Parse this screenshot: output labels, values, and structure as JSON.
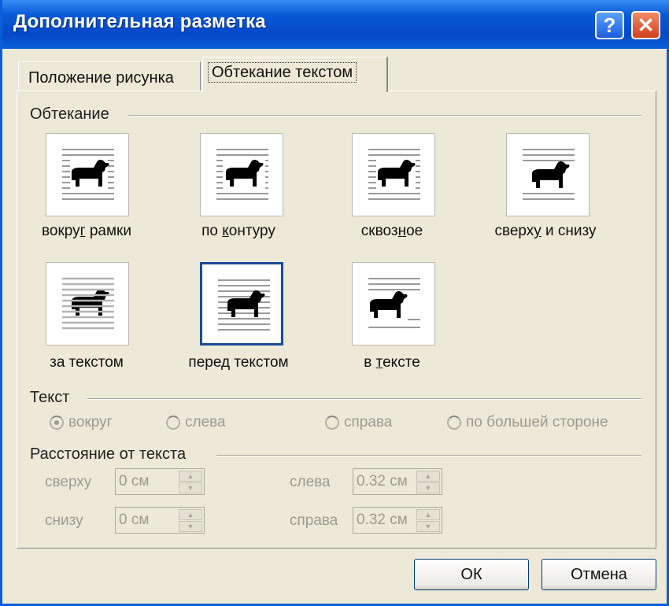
{
  "window": {
    "title": "Дополнительная разметка",
    "help_icon": "?",
    "close_icon": "✕"
  },
  "tabs": [
    {
      "label": "Положение рисунка",
      "active": false
    },
    {
      "label": "Обтекание текстом",
      "active": true
    }
  ],
  "wrapping": {
    "group_label": "Обтекание",
    "options": [
      {
        "pre": "вокру",
        "ul": "г",
        "post": " рамки",
        "icon": "square-wrap-icon",
        "selected": false
      },
      {
        "pre": "по ",
        "ul": "к",
        "post": "онтуру",
        "icon": "tight-wrap-icon",
        "selected": false
      },
      {
        "pre": "сквоз",
        "ul": "н",
        "post": "ое",
        "icon": "through-wrap-icon",
        "selected": false
      },
      {
        "pre": "сверх",
        "ul": "у",
        "post": " и снизу",
        "icon": "top-bottom-wrap-icon",
        "selected": false
      },
      {
        "pre": "за текстом",
        "ul": "",
        "post": "",
        "icon": "behind-text-icon",
        "selected": false
      },
      {
        "pre": "перед",
        "ul": "",
        "post": " текстом",
        "icon": "in-front-text-icon",
        "selected": true
      },
      {
        "pre": "в ",
        "ul": "т",
        "post": "ексте",
        "icon": "inline-text-icon",
        "selected": false
      }
    ]
  },
  "text_side": {
    "group_label": "Текст",
    "options": [
      {
        "label": "вокруг",
        "checked": true
      },
      {
        "label": "слева",
        "checked": false
      },
      {
        "label": "справа",
        "checked": false
      },
      {
        "label": "по большей стороне",
        "checked": false
      }
    ]
  },
  "distance": {
    "group_label": "Расстояние от текста",
    "top": {
      "label": "сверху",
      "value": "0 см"
    },
    "bottom": {
      "label": "снизу",
      "value": "0 см"
    },
    "left": {
      "label": "слева",
      "value": "0.32 см"
    },
    "right": {
      "label": "справа",
      "value": "0.32 см"
    }
  },
  "buttons": {
    "ok": "ОК",
    "cancel": "Отмена"
  },
  "colors": {
    "title_bar": "#0a5ed6",
    "dialog_bg": "#ece9d8",
    "selection_border": "#1c4a96"
  }
}
